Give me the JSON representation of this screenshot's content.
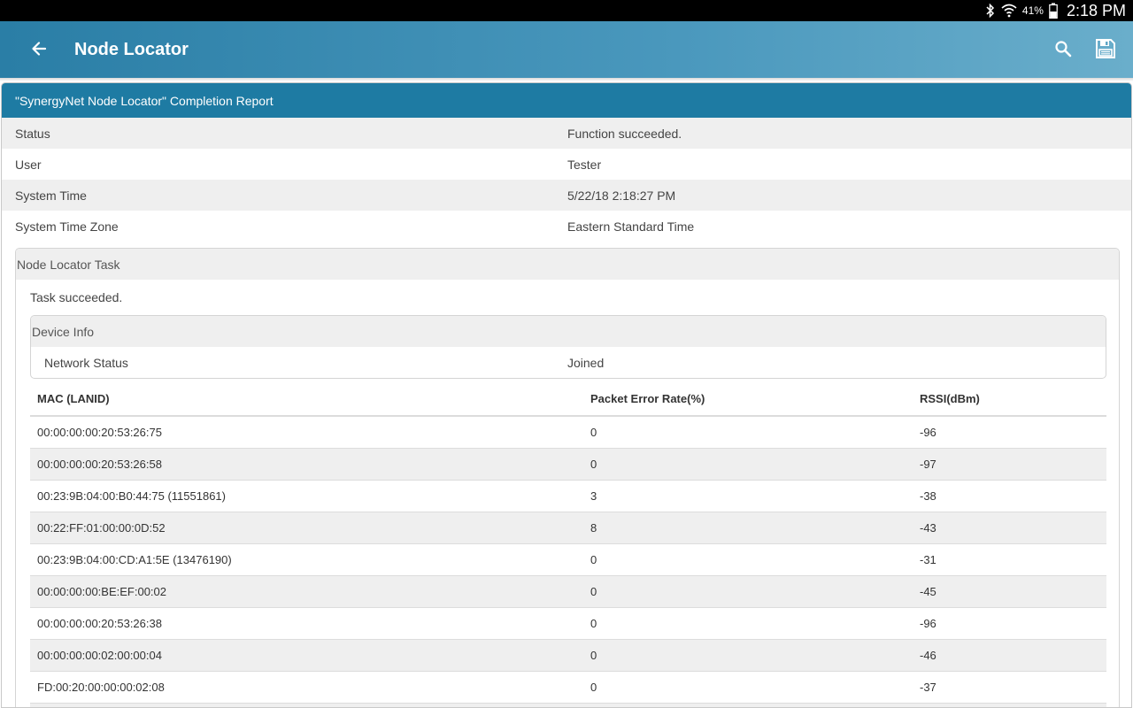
{
  "status_bar": {
    "battery": "41%",
    "time": "2:18 PM",
    "icons": [
      "bluetooth-icon",
      "wifi-icon",
      "battery-icon"
    ]
  },
  "app_bar": {
    "title": "Node Locator",
    "back_icon": "arrow-left-icon",
    "search_icon": "search-icon",
    "save_icon": "save-icon"
  },
  "report": {
    "header": "\"SynergyNet Node Locator\" Completion Report",
    "fields": [
      {
        "key": "Status",
        "value": "Function succeeded."
      },
      {
        "key": "User",
        "value": "Tester"
      },
      {
        "key": "System Time",
        "value": "5/22/18 2:18:27 PM"
      },
      {
        "key": "System Time Zone",
        "value": "Eastern Standard Time"
      }
    ],
    "task": {
      "title": "Node Locator Task",
      "status": "Task succeeded.",
      "device_info": {
        "title": "Device Info",
        "rows": [
          {
            "key": "Network Status",
            "value": "Joined"
          }
        ]
      },
      "table": {
        "columns": [
          "MAC (LANID)",
          "Packet Error Rate(%)",
          "RSSI(dBm)"
        ],
        "rows": [
          [
            "00:00:00:00:20:53:26:75",
            "0",
            "-96"
          ],
          [
            "00:00:00:00:20:53:26:58",
            "0",
            "-97"
          ],
          [
            "00:23:9B:04:00:B0:44:75 (11551861)",
            "3",
            "-38"
          ],
          [
            "00:22:FF:01:00:00:0D:52",
            "8",
            "-43"
          ],
          [
            "00:23:9B:04:00:CD:A1:5E (13476190)",
            "0",
            "-31"
          ],
          [
            "00:00:00:00:BE:EF:00:02",
            "0",
            "-45"
          ],
          [
            "00:00:00:00:20:53:26:38",
            "0",
            "-96"
          ],
          [
            "00:00:00:00:02:00:00:04",
            "0",
            "-46"
          ],
          [
            "FD:00:20:00:00:00:02:08",
            "0",
            "-37"
          ]
        ]
      }
    }
  },
  "colors": {
    "app_bar": "#2a7ea6",
    "report_header": "#1e7ba3",
    "row_shade": "#efefef"
  }
}
